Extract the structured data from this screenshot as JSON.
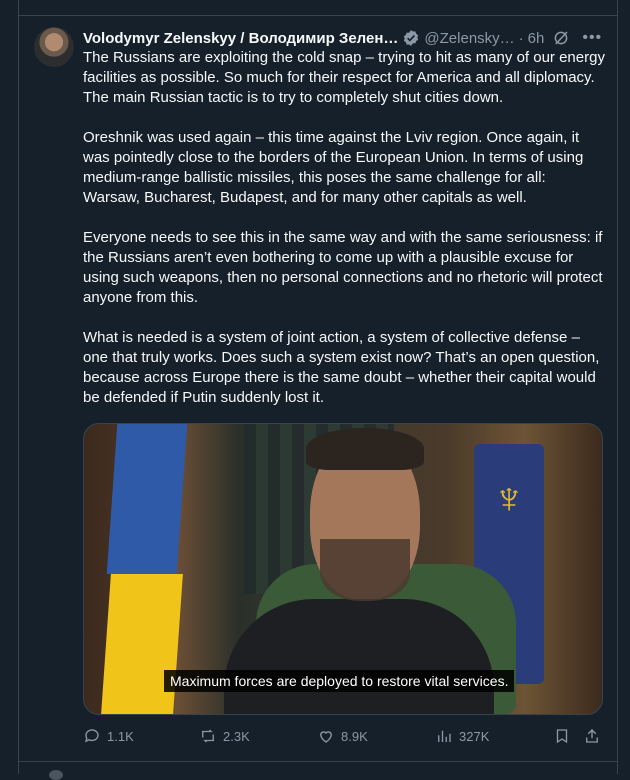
{
  "tweet": {
    "author_name": "Volodymyr Zelenskyy / Володимир Зелен…",
    "handle": "@Zelensky…",
    "time_separator": "·",
    "time": "6h",
    "more_label": "•••",
    "paragraphs": [
      "The Russians are exploiting the cold snap – trying to hit as many of our energy facilities as possible. So much for their respect for America and all diplomacy. The main Russian tactic is to try to completely shut cities down.",
      "Oreshnik was used again – this time against the Lviv region. Once again, it was pointedly close to the borders of the European Union. In terms of using medium-range ballistic missiles, this poses the same challenge for all: Warsaw, Bucharest, Budapest, and for many other capitals as well.",
      "Everyone needs to see this in the same way and with the same seriousness: if the Russians aren’t even bothering to come up with a plausible excuse for using such weapons, then no personal connections and no rhetoric will protect anyone from this.",
      "What is needed is a system of joint action, a system of collective defense – one that truly works. Does such a system exist now? That’s an open question, because across Europe there is the same doubt – whether their capital would be defended if Putin suddenly lost it."
    ],
    "media": {
      "subtitle": "Maximum forces are deployed to restore vital services."
    },
    "actions": {
      "replies": "1.1K",
      "reposts": "2.3K",
      "likes": "8.9K",
      "views": "327K"
    },
    "colors": {
      "background": "#15202b",
      "text": "#f7f9f9",
      "secondary": "#8b98a5",
      "verified": "#1d9bf0",
      "border": "#38444d"
    }
  }
}
